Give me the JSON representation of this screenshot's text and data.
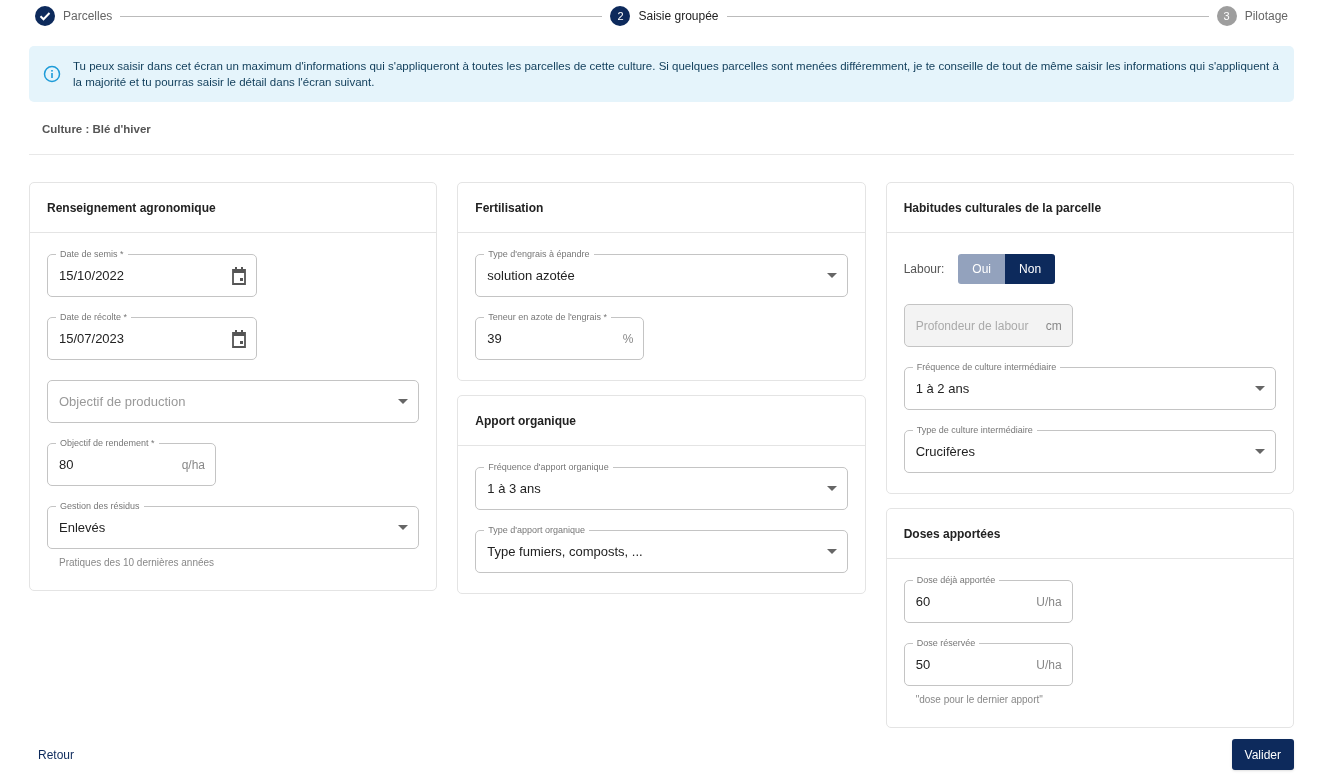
{
  "stepper": [
    {
      "completed": true,
      "selected": false,
      "label": "Parcelles"
    },
    {
      "completed": false,
      "selected": true,
      "number": "2",
      "label": "Saisie groupée"
    },
    {
      "completed": false,
      "selected": false,
      "number": "3",
      "label": "Pilotage"
    }
  ],
  "info": "Tu peux saisir dans cet écran un maximum d'informations qui s'appliqueront à toutes les parcelles de cette culture. Si quelques parcelles sont menées différemment, je te conseille de tout de même saisir les informations qui s'appliquent à la majorité et tu pourras saisir le détail dans l'écran suivant.",
  "culture": "Culture : Blé d'hiver",
  "columns": [
    [
      {
        "title": "Renseignement agronomique",
        "fields": [
          {
            "kind": "date",
            "label": "Date de semis *",
            "value": "15/10/2022"
          },
          {
            "kind": "date",
            "label": "Date de récolte *",
            "value": "15/07/2023"
          },
          {
            "kind": "select",
            "placeholder": "Objectif de production"
          },
          {
            "kind": "unit",
            "label": "Objectif de rendement *",
            "value": "80",
            "unit": "q/ha"
          },
          {
            "kind": "select",
            "label": "Gestion des résidus",
            "value": "Enlevés",
            "helper": "Pratiques des 10 dernières années"
          }
        ]
      }
    ],
    [
      {
        "title": "Fertilisation",
        "fields": [
          {
            "kind": "select",
            "label": "Type d'engrais à épandre",
            "value": "solution azotée"
          },
          {
            "kind": "unit",
            "label": "Teneur en azote de l'engrais *",
            "value": "39",
            "unit": "%"
          }
        ]
      },
      {
        "title": "Apport organique",
        "fields": [
          {
            "kind": "select",
            "label": "Fréquence d'apport organique",
            "value": "1 à 3 ans"
          },
          {
            "kind": "select",
            "label": "Type d'apport organique",
            "value": "Type fumiers, composts, ..."
          }
        ]
      }
    ],
    [
      {
        "title": "Habitudes culturales de la parcelle",
        "fields": [
          {
            "kind": "toggle",
            "label": "Labour:",
            "options": [
              {
                "label": "Oui",
                "selected": false
              },
              {
                "label": "Non",
                "selected": true
              }
            ]
          },
          {
            "kind": "unit",
            "placeholder": "Profondeur de labour",
            "unit": "cm",
            "disabled": true
          },
          {
            "kind": "select",
            "label": "Fréquence de culture intermédiaire",
            "value": "1 à 2 ans"
          },
          {
            "kind": "select",
            "label": "Type de culture intermédiaire",
            "value": "Crucifères"
          }
        ]
      },
      {
        "title": "Doses apportées",
        "fields": [
          {
            "kind": "unit",
            "label": "Dose déjà apportée",
            "value": "60",
            "unit": "U/ha"
          },
          {
            "kind": "unit",
            "label": "Dose réservée",
            "value": "50",
            "unit": "U/ha",
            "helper": "\"dose pour le dernier apport\""
          }
        ]
      }
    ]
  ],
  "footer": {
    "back": "Retour",
    "submit": "Valider"
  }
}
